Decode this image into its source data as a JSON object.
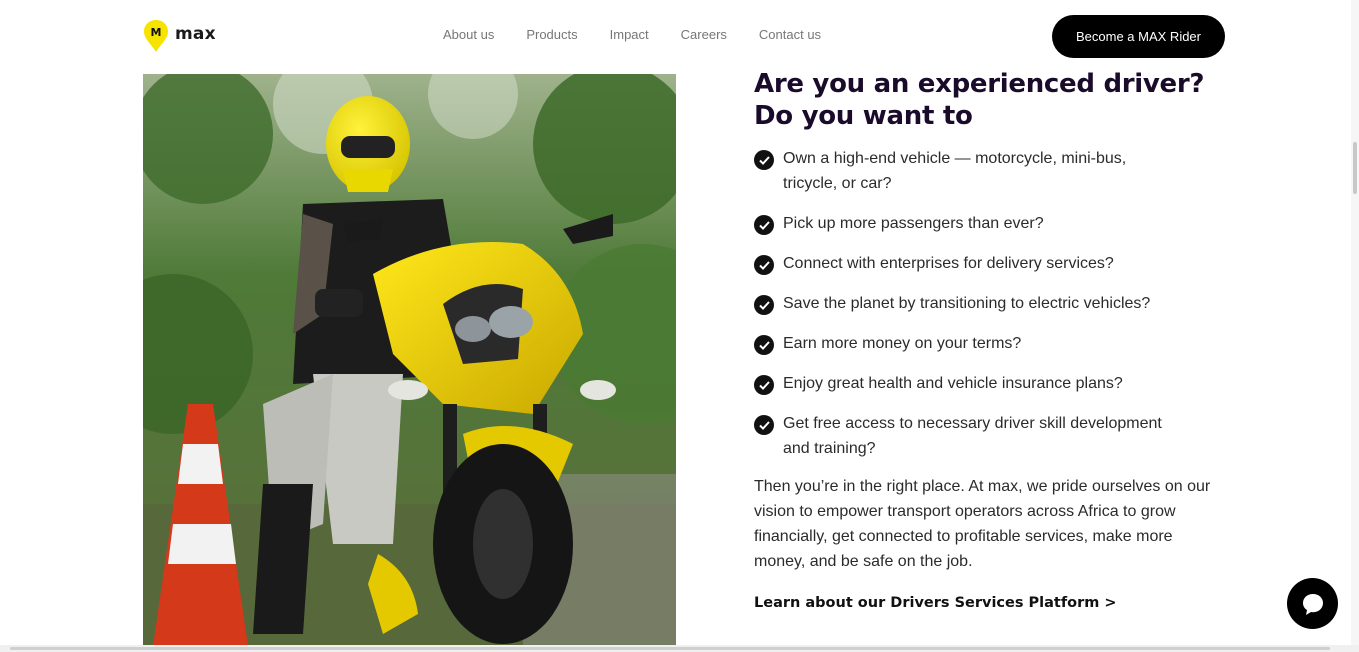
{
  "brand": {
    "name": "max",
    "logo_letter": "M",
    "accent": "#f7e300"
  },
  "nav": {
    "items": [
      {
        "label": "About us"
      },
      {
        "label": "Products"
      },
      {
        "label": "Impact"
      },
      {
        "label": "Careers"
      },
      {
        "label": "Contact us"
      }
    ],
    "cta_label": "Become a MAX Rider"
  },
  "hero_image": {
    "subject": "rider on yellow motorcycle with helmet next to traffic cone"
  },
  "content": {
    "headline": "Are you an experienced driver? Do you want to",
    "checklist": [
      "Own a high-end vehicle — motorcycle, mini-bus, tricycle, or car?",
      "Pick up more passengers than ever?",
      "Connect with enterprises for delivery services?",
      "Save the planet by transitioning to electric vehicles?",
      "Earn more money on your terms?",
      "Enjoy great health and vehicle insurance plans?",
      "Get free access to necessary driver skill development and training?"
    ],
    "paragraph": "Then you’re in the right place. At max, we pride ourselves on our vision to empower transport operators across Africa to grow financially, get connected to profitable services, make more money, and be safe on the job.",
    "link_label": "Learn about our Drivers Services Platform >"
  },
  "chat": {
    "icon": "chat-bubble-icon"
  },
  "colors": {
    "headline": "#1a0b2b",
    "button_bg": "#000000",
    "check_bg": "#111111"
  }
}
